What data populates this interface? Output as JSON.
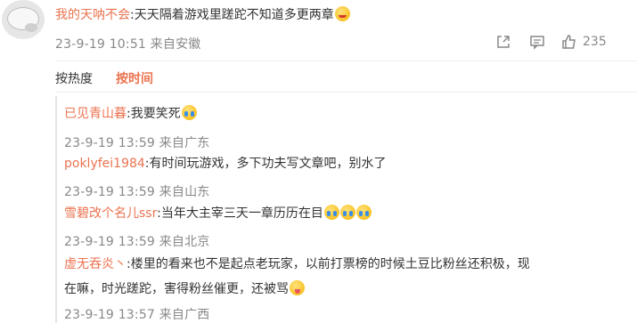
{
  "post": {
    "username": "我的天呐不会",
    "text": ":天天隔着游戏里蹉跎不知道多更两章",
    "emoji": "face-emoji",
    "meta": "23-9-19 10:51 来自安徽",
    "like_count": "235"
  },
  "sort": {
    "hot_label": "按热度",
    "time_label": "按时间"
  },
  "replies": [
    {
      "username": "已见青山暮",
      "text": ":我要笑死",
      "emojis": [
        "laugh-cry-emoji"
      ],
      "meta": "23-9-19 13:59 来自广东"
    },
    {
      "username": "poklyfei1984",
      "text": ":有时间玩游戏，多下功夫写文章吧，别水了",
      "emojis": [],
      "meta": "23-9-19 13:59 来自山东"
    },
    {
      "username": "雪碧改个名儿ssr",
      "text": ":当年大主宰三天一章历历在目",
      "emojis": [
        "crying-emoji",
        "crying-emoji",
        "crying-emoji"
      ],
      "meta": "23-9-19 13:59 来自北京"
    },
    {
      "username": "虚无吞炎丶",
      "text_line1": ":楼里的看来也不是起点老玩家，以前打票榜的时候土豆比粉丝还积极，现",
      "text_line2": "在嘛，时光蹉跎，害得粉丝催更，还被骂",
      "emojis": [
        "tongue-emoji"
      ],
      "meta": "23-9-19 13:57 来自广西"
    }
  ]
}
